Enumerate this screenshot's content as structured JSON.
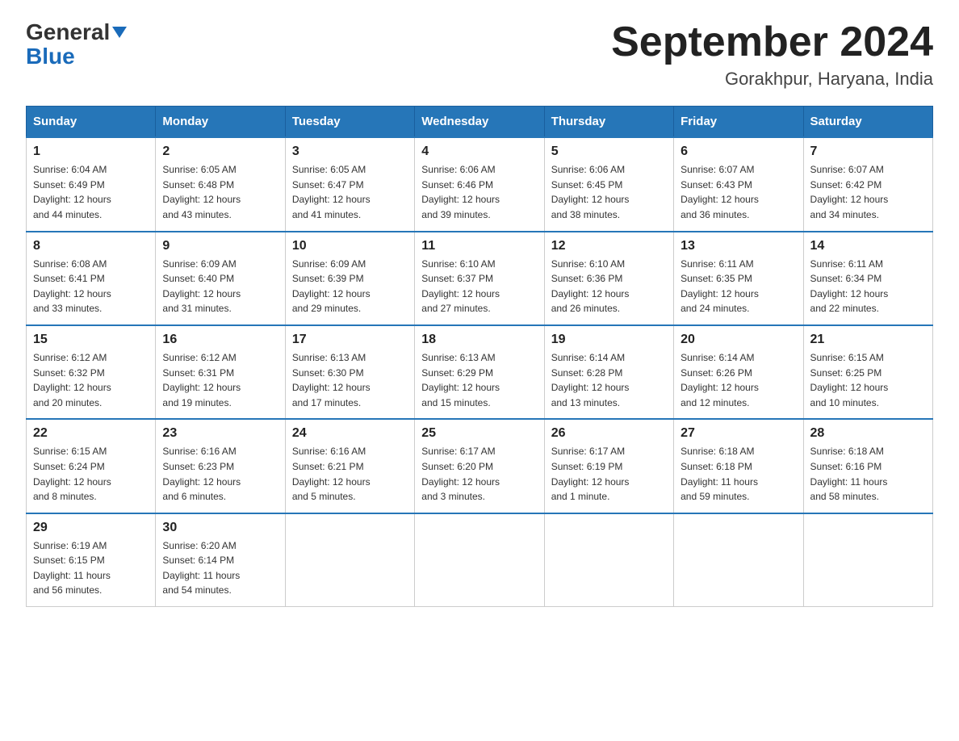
{
  "logo": {
    "general": "General",
    "blue": "Blue"
  },
  "header": {
    "title": "September 2024",
    "subtitle": "Gorakhpur, Haryana, India"
  },
  "weekdays": [
    "Sunday",
    "Monday",
    "Tuesday",
    "Wednesday",
    "Thursday",
    "Friday",
    "Saturday"
  ],
  "weeks": [
    [
      {
        "day": "1",
        "sunrise": "6:04 AM",
        "sunset": "6:49 PM",
        "daylight": "12 hours and 44 minutes."
      },
      {
        "day": "2",
        "sunrise": "6:05 AM",
        "sunset": "6:48 PM",
        "daylight": "12 hours and 43 minutes."
      },
      {
        "day": "3",
        "sunrise": "6:05 AM",
        "sunset": "6:47 PM",
        "daylight": "12 hours and 41 minutes."
      },
      {
        "day": "4",
        "sunrise": "6:06 AM",
        "sunset": "6:46 PM",
        "daylight": "12 hours and 39 minutes."
      },
      {
        "day": "5",
        "sunrise": "6:06 AM",
        "sunset": "6:45 PM",
        "daylight": "12 hours and 38 minutes."
      },
      {
        "day": "6",
        "sunrise": "6:07 AM",
        "sunset": "6:43 PM",
        "daylight": "12 hours and 36 minutes."
      },
      {
        "day": "7",
        "sunrise": "6:07 AM",
        "sunset": "6:42 PM",
        "daylight": "12 hours and 34 minutes."
      }
    ],
    [
      {
        "day": "8",
        "sunrise": "6:08 AM",
        "sunset": "6:41 PM",
        "daylight": "12 hours and 33 minutes."
      },
      {
        "day": "9",
        "sunrise": "6:09 AM",
        "sunset": "6:40 PM",
        "daylight": "12 hours and 31 minutes."
      },
      {
        "day": "10",
        "sunrise": "6:09 AM",
        "sunset": "6:39 PM",
        "daylight": "12 hours and 29 minutes."
      },
      {
        "day": "11",
        "sunrise": "6:10 AM",
        "sunset": "6:37 PM",
        "daylight": "12 hours and 27 minutes."
      },
      {
        "day": "12",
        "sunrise": "6:10 AM",
        "sunset": "6:36 PM",
        "daylight": "12 hours and 26 minutes."
      },
      {
        "day": "13",
        "sunrise": "6:11 AM",
        "sunset": "6:35 PM",
        "daylight": "12 hours and 24 minutes."
      },
      {
        "day": "14",
        "sunrise": "6:11 AM",
        "sunset": "6:34 PM",
        "daylight": "12 hours and 22 minutes."
      }
    ],
    [
      {
        "day": "15",
        "sunrise": "6:12 AM",
        "sunset": "6:32 PM",
        "daylight": "12 hours and 20 minutes."
      },
      {
        "day": "16",
        "sunrise": "6:12 AM",
        "sunset": "6:31 PM",
        "daylight": "12 hours and 19 minutes."
      },
      {
        "day": "17",
        "sunrise": "6:13 AM",
        "sunset": "6:30 PM",
        "daylight": "12 hours and 17 minutes."
      },
      {
        "day": "18",
        "sunrise": "6:13 AM",
        "sunset": "6:29 PM",
        "daylight": "12 hours and 15 minutes."
      },
      {
        "day": "19",
        "sunrise": "6:14 AM",
        "sunset": "6:28 PM",
        "daylight": "12 hours and 13 minutes."
      },
      {
        "day": "20",
        "sunrise": "6:14 AM",
        "sunset": "6:26 PM",
        "daylight": "12 hours and 12 minutes."
      },
      {
        "day": "21",
        "sunrise": "6:15 AM",
        "sunset": "6:25 PM",
        "daylight": "12 hours and 10 minutes."
      }
    ],
    [
      {
        "day": "22",
        "sunrise": "6:15 AM",
        "sunset": "6:24 PM",
        "daylight": "12 hours and 8 minutes."
      },
      {
        "day": "23",
        "sunrise": "6:16 AM",
        "sunset": "6:23 PM",
        "daylight": "12 hours and 6 minutes."
      },
      {
        "day": "24",
        "sunrise": "6:16 AM",
        "sunset": "6:21 PM",
        "daylight": "12 hours and 5 minutes."
      },
      {
        "day": "25",
        "sunrise": "6:17 AM",
        "sunset": "6:20 PM",
        "daylight": "12 hours and 3 minutes."
      },
      {
        "day": "26",
        "sunrise": "6:17 AM",
        "sunset": "6:19 PM",
        "daylight": "12 hours and 1 minute."
      },
      {
        "day": "27",
        "sunrise": "6:18 AM",
        "sunset": "6:18 PM",
        "daylight": "11 hours and 59 minutes."
      },
      {
        "day": "28",
        "sunrise": "6:18 AM",
        "sunset": "6:16 PM",
        "daylight": "11 hours and 58 minutes."
      }
    ],
    [
      {
        "day": "29",
        "sunrise": "6:19 AM",
        "sunset": "6:15 PM",
        "daylight": "11 hours and 56 minutes."
      },
      {
        "day": "30",
        "sunrise": "6:20 AM",
        "sunset": "6:14 PM",
        "daylight": "11 hours and 54 minutes."
      },
      null,
      null,
      null,
      null,
      null
    ]
  ],
  "labels": {
    "sunrise": "Sunrise:",
    "sunset": "Sunset:",
    "daylight": "Daylight:"
  }
}
